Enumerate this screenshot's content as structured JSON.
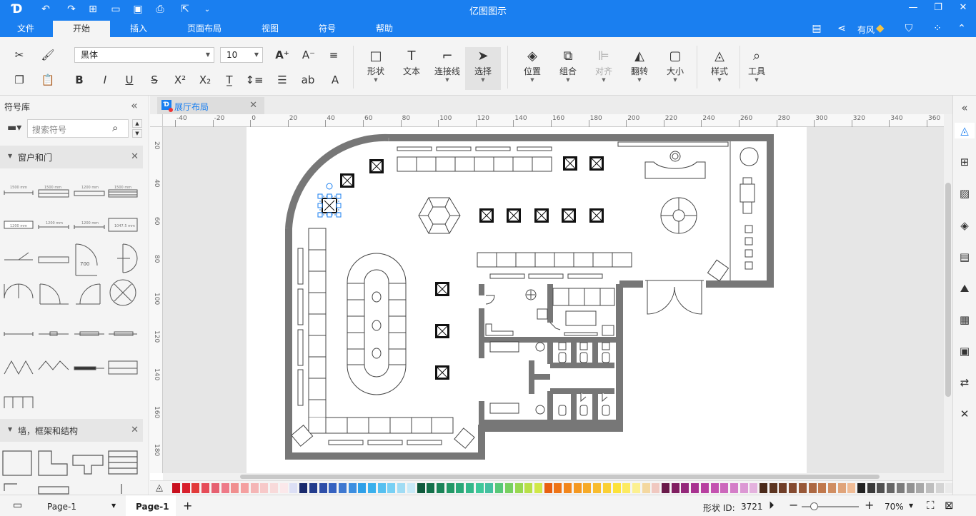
{
  "app": {
    "title": "亿图图示"
  },
  "quick_access": {
    "icons": [
      "logo-icon",
      "undo-icon",
      "redo-icon",
      "new-icon",
      "open-icon",
      "save-icon",
      "print-icon",
      "export-icon",
      "customize-icon"
    ]
  },
  "menu": {
    "tabs": [
      "文件",
      "开始",
      "插入",
      "页面布局",
      "视图",
      "符号",
      "帮助"
    ],
    "active": "开始"
  },
  "user": {
    "name": "有风"
  },
  "ribbon": {
    "font_name": "黑体",
    "font_size": "10",
    "groups": {
      "shape": "形状",
      "text": "文本",
      "connector": "连接线",
      "select": "选择",
      "position": "位置",
      "group": "组合",
      "align": "对齐",
      "flip": "翻转",
      "size": "大小",
      "style": "样式",
      "tools": "工具"
    }
  },
  "library": {
    "title": "符号库",
    "search_placeholder": "搜索符号",
    "sections": [
      {
        "name": "窗户和门"
      },
      {
        "name": "墙，框架和结构"
      }
    ],
    "symbol_labels": [
      "1500 mm",
      "1500 mm",
      "1200 mm",
      "1500 mm",
      "1200 mm",
      "1200 mm",
      "1200 mm",
      "1047.5 mm",
      "700"
    ]
  },
  "document": {
    "tab": "展厅布局"
  },
  "ruler": {
    "h_labels": [
      "-40",
      "-20",
      "0",
      "20",
      "40",
      "60",
      "80",
      "100",
      "120",
      "140",
      "160",
      "180",
      "200",
      "220",
      "240",
      "260",
      "280",
      "300",
      "320",
      "340",
      "360"
    ],
    "v_labels": [
      "20",
      "40",
      "60",
      "80",
      "100",
      "120",
      "140",
      "160",
      "180"
    ]
  },
  "status": {
    "page_selector": "Page-1",
    "page_tab": "Page-1",
    "shape_id_label": "形状 ID:",
    "shape_id": "3721",
    "zoom": "70%"
  },
  "palette_colors": [
    "#c8101e",
    "#d8202c",
    "#e23a3a",
    "#e64c58",
    "#e66070",
    "#ee7a88",
    "#f08f8f",
    "#f4a0a0",
    "#f4b5b5",
    "#f7c9c9",
    "#f8dada",
    "#fbe8ea",
    "#dcdff5",
    "#1a2a6c",
    "#233c8c",
    "#2e4ea8",
    "#3662c0",
    "#3f78d0",
    "#3c8ee0",
    "#2ea0e8",
    "#3ab0ec",
    "#56c0f0",
    "#78d0f4",
    "#a0dcf4",
    "#c8eaf8",
    "#0e5a3c",
    "#13704a",
    "#1a8458",
    "#229866",
    "#2aa878",
    "#34b88a",
    "#3ec89a",
    "#44c0a0",
    "#58c878",
    "#78d060",
    "#98d850",
    "#b8e048",
    "#d0e848",
    "#e86010",
    "#ee7416",
    "#f2861c",
    "#f49822",
    "#f6aa28",
    "#f8bc2e",
    "#fad034",
    "#fce23a",
    "#fcea60",
    "#fcf090",
    "#f4d8a0",
    "#f0c8c0",
    "#6a1a4a",
    "#801e60",
    "#94287a",
    "#a83290",
    "#b840a0",
    "#c452b0",
    "#cc68bc",
    "#d47ec8",
    "#dc98d4",
    "#e4b2de",
    "#4a2a1a",
    "#5c3420",
    "#703e28",
    "#844a30",
    "#985838",
    "#ac6842",
    "#c0784c",
    "#d08e62",
    "#e0a47a",
    "#f0bc96",
    "#222222",
    "#3a3a3a",
    "#505050",
    "#666666",
    "#7c7c7c",
    "#929292",
    "#a8a8a8",
    "#bebebe",
    "#d4d4d4",
    "#eaeaea"
  ]
}
